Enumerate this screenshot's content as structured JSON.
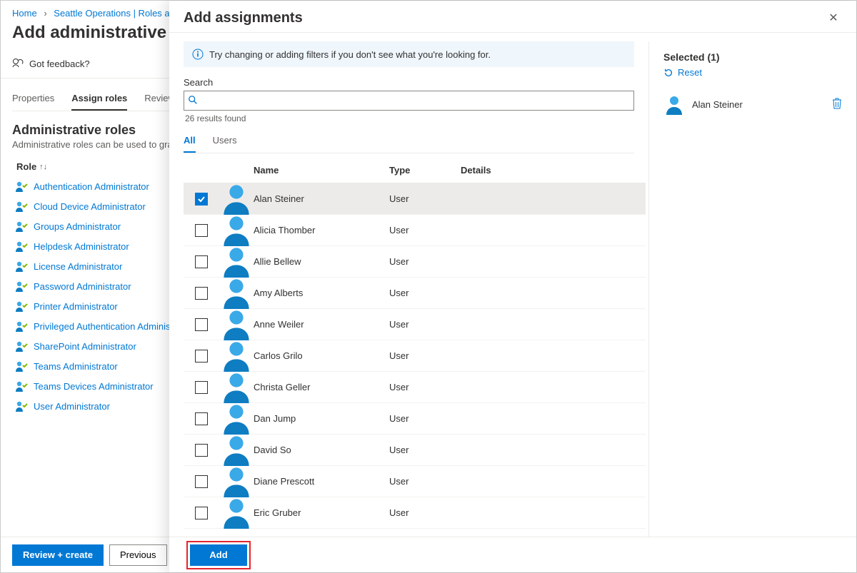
{
  "breadcrumb": {
    "home": "Home",
    "link2": "Seattle Operations | Roles and"
  },
  "page_title": "Add administrative uni",
  "feedback": "Got feedback?",
  "bg_tabs": {
    "properties": "Properties",
    "assign": "Assign roles",
    "review": "Review"
  },
  "section": {
    "title": "Administrative roles",
    "sub": "Administrative roles can be used to grant"
  },
  "role_col": "Role",
  "roles": [
    "Authentication Administrator",
    "Cloud Device Administrator",
    "Groups Administrator",
    "Helpdesk Administrator",
    "License Administrator",
    "Password Administrator",
    "Printer Administrator",
    "Privileged Authentication Administ…",
    "SharePoint Administrator",
    "Teams Administrator",
    "Teams Devices Administrator",
    "User Administrator"
  ],
  "bottom": {
    "review_create": "Review + create",
    "previous": "Previous",
    "add": "Add"
  },
  "panel": {
    "title": "Add assignments",
    "info": "Try changing or adding filters if you don't see what you're looking for.",
    "search_label": "Search",
    "results": "26 results found",
    "tabs": {
      "all": "All",
      "users": "Users"
    },
    "cols": {
      "name": "Name",
      "type": "Type",
      "details": "Details"
    },
    "rows": [
      {
        "name": "Alan Steiner",
        "type": "User",
        "sel": true
      },
      {
        "name": "Alicia Thomber",
        "type": "User",
        "sel": false
      },
      {
        "name": "Allie Bellew",
        "type": "User",
        "sel": false
      },
      {
        "name": "Amy Alberts",
        "type": "User",
        "sel": false
      },
      {
        "name": "Anne Weiler",
        "type": "User",
        "sel": false
      },
      {
        "name": "Carlos Grilo",
        "type": "User",
        "sel": false
      },
      {
        "name": "Christa Geller",
        "type": "User",
        "sel": false
      },
      {
        "name": "Dan Jump",
        "type": "User",
        "sel": false
      },
      {
        "name": "David So",
        "type": "User",
        "sel": false
      },
      {
        "name": "Diane Prescott",
        "type": "User",
        "sel": false
      },
      {
        "name": "Eric Gruber",
        "type": "User",
        "sel": false
      }
    ],
    "selected_title": "Selected (1)",
    "reset": "Reset",
    "selected_name": "Alan Steiner"
  }
}
